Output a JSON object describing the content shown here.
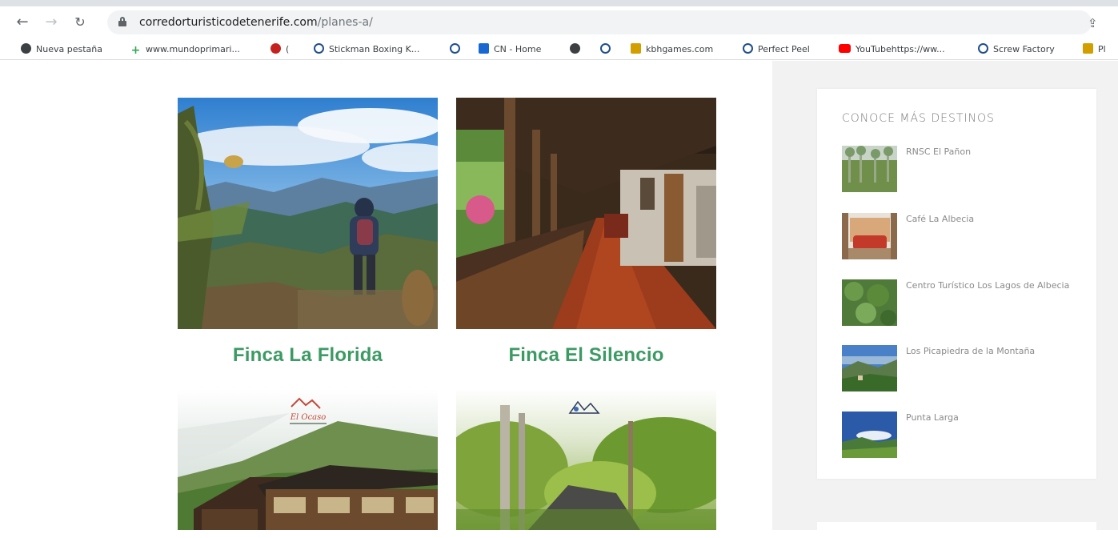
{
  "browser": {
    "url_domain": "corredorturisticodetenerife.com",
    "url_path": "/planes-a/",
    "bookmarks": [
      {
        "label": "Nueva pestaña",
        "icon": "globe-icon"
      },
      {
        "label": "www.mundoprimari...",
        "icon": "plus-icon"
      },
      {
        "label": "(",
        "icon": "red-icon"
      },
      {
        "label": "Stickman Boxing K...",
        "icon": "ring-icon"
      },
      {
        "label": "",
        "icon": "ring-icon"
      },
      {
        "label": "CN - Home",
        "icon": "cn-icon"
      },
      {
        "label": "",
        "icon": "globe-icon"
      },
      {
        "label": "",
        "icon": "ring-icon"
      },
      {
        "label": "kbhgames.com",
        "icon": "yellow-icon"
      },
      {
        "label": "Perfect Peel",
        "icon": "ring-icon"
      },
      {
        "label": "YouTubehttps://ww...",
        "icon": "youtube-icon"
      },
      {
        "label": "Screw Factory",
        "icon": "ring-icon"
      },
      {
        "label": "Pl",
        "icon": "yellow-icon"
      }
    ]
  },
  "cards": [
    {
      "title": "Finca La Florida",
      "scene": "mountain-hiker"
    },
    {
      "title": "Finca El Silencio",
      "scene": "wooden-corridor"
    },
    {
      "title": "",
      "scene": "mountain-lodge",
      "logo_text": "El Ocaso"
    },
    {
      "title": "",
      "scene": "forest-cabin"
    }
  ],
  "sidebar": {
    "title": "CONOCE MÁS DESTINOS",
    "items": [
      {
        "name": "RNSC El Pañon"
      },
      {
        "name": "Café La Albecia"
      },
      {
        "name": "Centro Turístico Los Lagos de Albecia"
      },
      {
        "name": "Los Picapiedra de la Montaña"
      },
      {
        "name": "Punta Larga"
      }
    ]
  },
  "colors": {
    "title_green": "#3c9a63",
    "sidebar_bg": "#f2f2f2"
  }
}
